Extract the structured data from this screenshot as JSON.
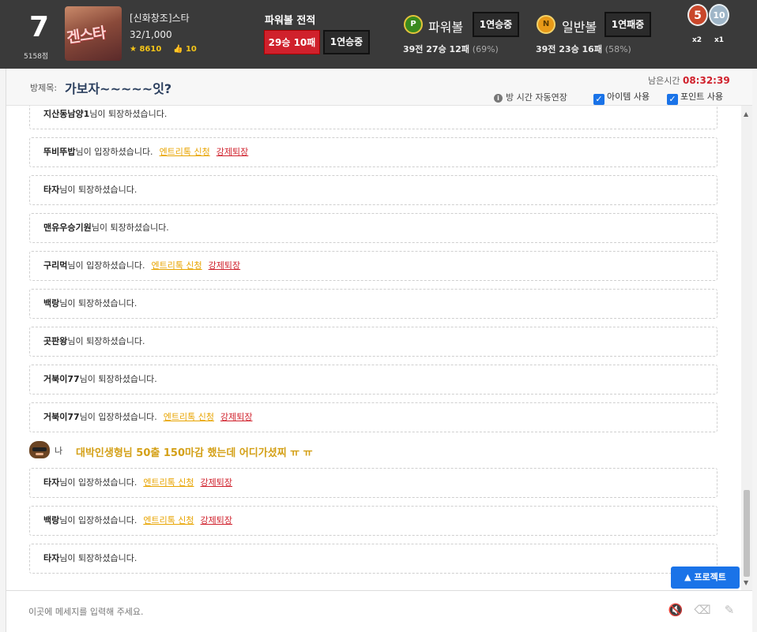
{
  "header": {
    "level": "7",
    "points": "5158점",
    "avatar_text": "겐스타",
    "user": {
      "name": "[신화창조]스타",
      "count": "32/1,000",
      "star_count": "8610",
      "thumb_count": "10"
    },
    "record_title": "파워볼 전적",
    "record_wl": "29승 10패",
    "record_streak": "1연승중",
    "powerball": {
      "icon": "P",
      "label": "파워볼",
      "streak": "1연승중",
      "stat": "39전 27승 12패",
      "pct": "(69%)"
    },
    "normalball": {
      "icon": "N",
      "label": "일반볼",
      "streak": "1연패중",
      "stat": "39전 23승 16패",
      "pct": "(58%)"
    },
    "medals": [
      {
        "num": "5",
        "count": "x2"
      },
      {
        "num": "10",
        "count": "x1"
      }
    ]
  },
  "room": {
    "title_label": "방제목:",
    "title": "가보자~~~~~잇?",
    "time_left_label": "남은시간",
    "time_left": "08:32:39",
    "auto_extend": "방 시간 자동연장",
    "item_use": "아이템 사용",
    "point_use": "포인트 사용"
  },
  "colors": {
    "entry": "#e8a400",
    "kick": "#d0212c",
    "accent": "#1a73e8"
  },
  "chat": {
    "entry_label": "엔트리톡 신청",
    "kick_label": "강제퇴장",
    "messages": [
      {
        "user": "지산동남양1",
        "text": "님이 퇴장하셨습니다."
      },
      {
        "user": "뚜비뚜밥",
        "text": "님이 입장하셨습니다."
      },
      {
        "user": "타자",
        "text": "님이 퇴장하셨습니다."
      },
      {
        "user": "맨유우승기원",
        "text": "님이 퇴장하셨습니다."
      },
      {
        "user": "구리먹",
        "text": "님이 입장하셨습니다."
      },
      {
        "user": "백랑",
        "text": "님이 퇴장하셨습니다."
      },
      {
        "user": "곳판왕",
        "text": "님이 퇴장하셨습니다."
      },
      {
        "user": "거북이77",
        "text": "님이 퇴장하셨습니다."
      },
      {
        "user": "거북이77",
        "text": "님이 입장하셨습니다."
      },
      {
        "user": "타자",
        "text": "님이 입장하셨습니다."
      },
      {
        "user": "백랑",
        "text": "님이 입장하셨습니다."
      },
      {
        "user": "타자",
        "text": "님이 퇴장하셨습니다."
      }
    ],
    "my_message": {
      "label": "나",
      "text": "대박인생형님 50출 150마감 했는데 어디가셨찌 ㅠ ㅠ"
    }
  },
  "protect_button": "▲ 프로젝트",
  "input": {
    "placeholder": "이곳에 메세지를 입력해 주세요."
  }
}
